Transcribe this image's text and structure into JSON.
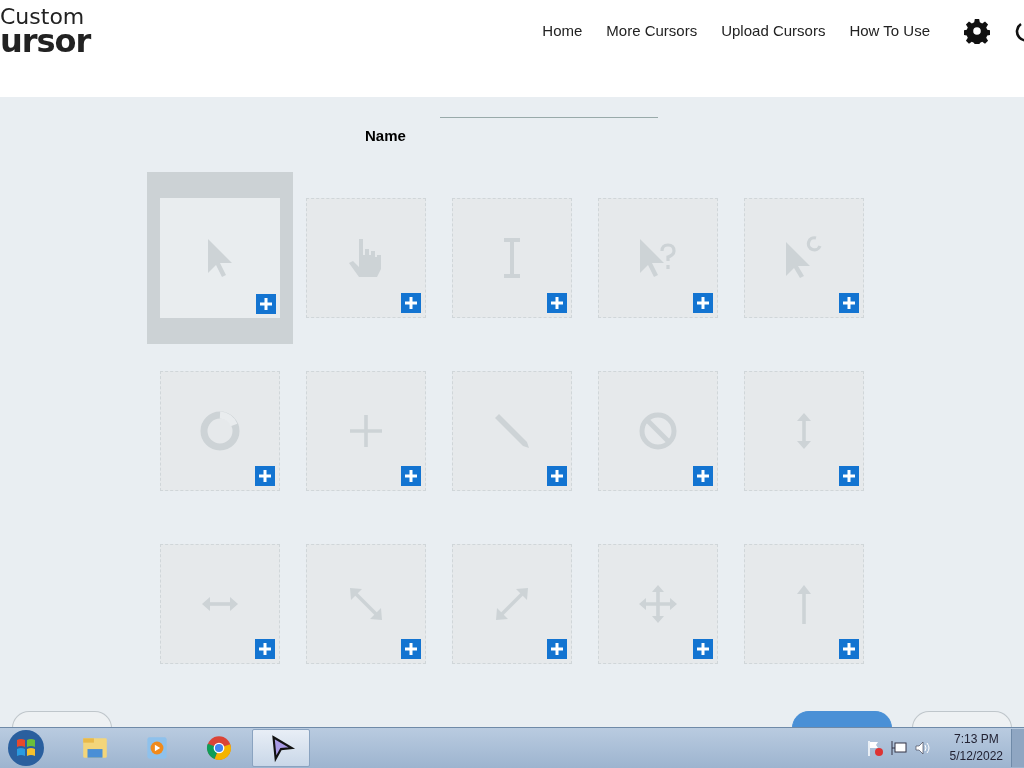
{
  "header": {
    "logo_top": "Custom",
    "logo_bottom": "ursor",
    "nav": [
      "Home",
      "More Cursors",
      "Upload Cursors",
      "How To Use"
    ]
  },
  "name_field": {
    "label": "Name"
  },
  "cursors": [
    {
      "kind": "arrow",
      "selected": true
    },
    {
      "kind": "hand",
      "selected": false
    },
    {
      "kind": "text",
      "selected": false
    },
    {
      "kind": "help",
      "selected": false
    },
    {
      "kind": "working",
      "selected": false
    },
    {
      "kind": "busy",
      "selected": false
    },
    {
      "kind": "crosshair",
      "selected": false
    },
    {
      "kind": "pen",
      "selected": false
    },
    {
      "kind": "unavailable",
      "selected": false
    },
    {
      "kind": "vresize",
      "selected": false
    },
    {
      "kind": "hresize",
      "selected": false
    },
    {
      "kind": "dresize1",
      "selected": false
    },
    {
      "kind": "dresize2",
      "selected": false
    },
    {
      "kind": "move",
      "selected": false
    },
    {
      "kind": "alternate",
      "selected": false
    }
  ],
  "buttons": [
    {
      "kind": "outline"
    },
    {
      "kind": "primary"
    },
    {
      "kind": "outline"
    }
  ],
  "taskbar": {
    "apps": [
      {
        "kind": "explorer",
        "selected": false
      },
      {
        "kind": "media",
        "selected": false
      },
      {
        "kind": "chrome",
        "selected": false
      },
      {
        "kind": "cursor",
        "selected": true
      }
    ],
    "time": "7:13 PM",
    "date": "5/12/2022"
  }
}
